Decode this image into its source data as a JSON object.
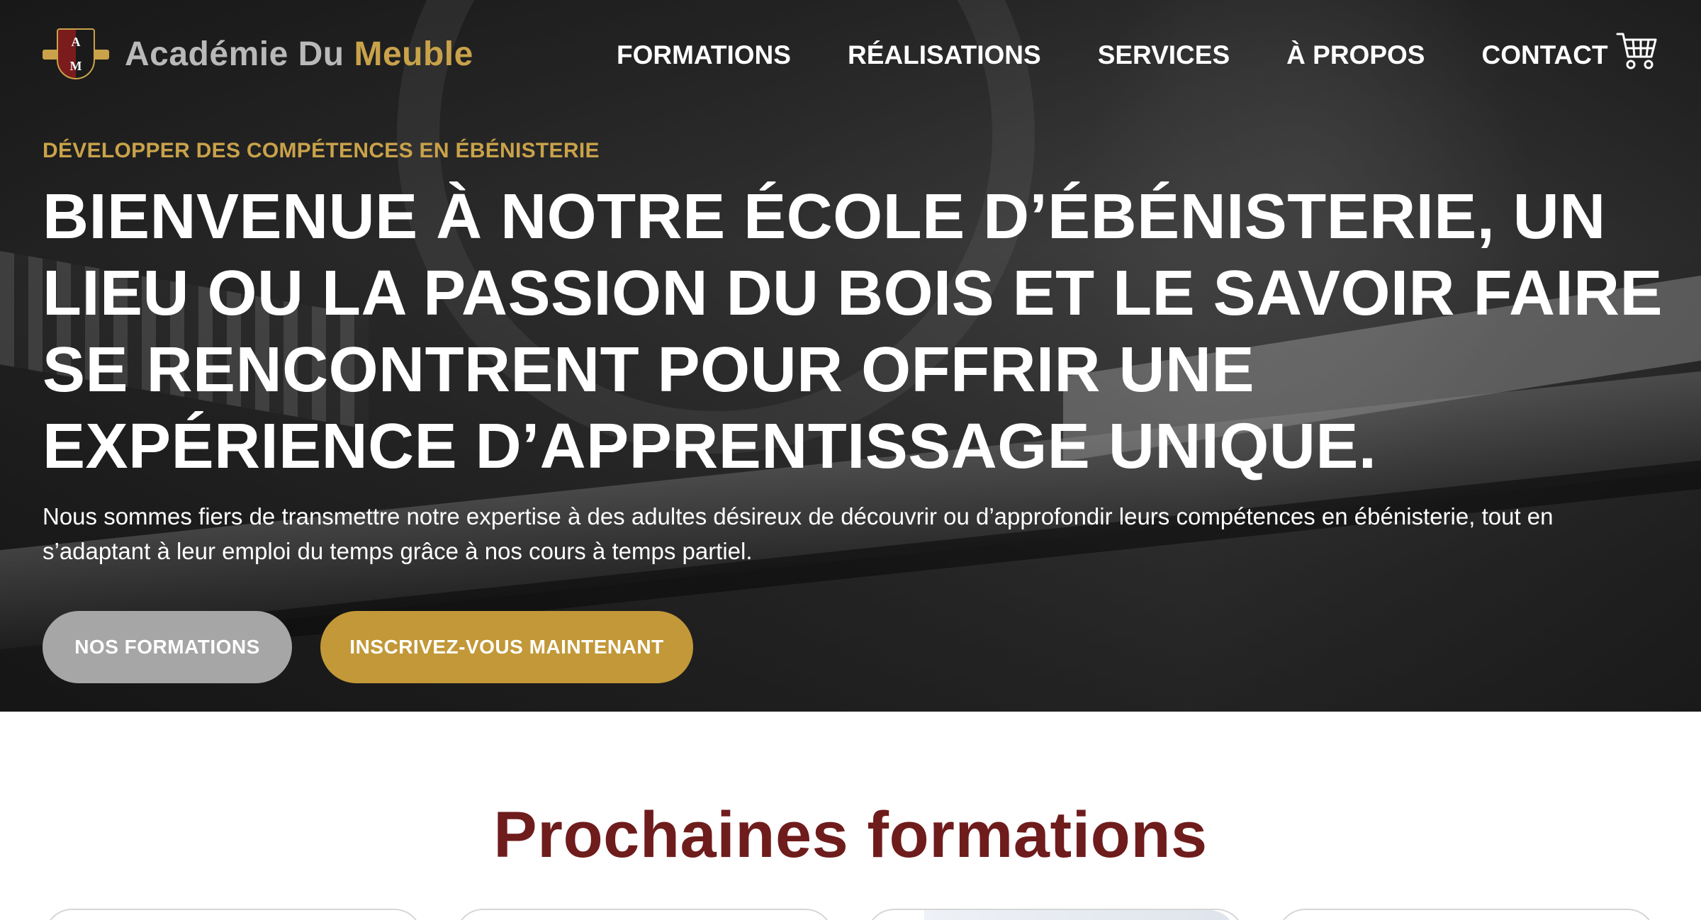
{
  "brand": {
    "name_part1": "Académie Du",
    "name_part2": "Meuble",
    "colors": {
      "gold": "#c9a24a",
      "grey": "#a6a6a6",
      "burgundy": "#6f1c1c"
    }
  },
  "nav": {
    "items": [
      {
        "label": "FORMATIONS"
      },
      {
        "label": "RÉALISATIONS"
      },
      {
        "label": "SERVICES"
      },
      {
        "label": "À PROPOS"
      },
      {
        "label": "CONTACT"
      }
    ],
    "cart_icon": "shopping-cart-icon"
  },
  "hero": {
    "kicker": "DÉVELOPPER DES COMPÉTENCES EN ÉBÉNISTERIE",
    "headline": "BIENVENUE À NOTRE ÉCOLE D’ÉBÉNISTERIE, UN LIEU OU LA PASSION DU BOIS ET LE SAVOIR FAIRE SE RENCONTRENT POUR OFFRIR UNE EXPÉRIENCE D’APPRENTISSAGE UNIQUE.",
    "lead": "Nous sommes fiers de transmettre notre expertise à des adultes désireux de découvrir ou d’approfondir leurs compétences en ébénisterie, tout en s’adaptant à leur emploi du temps grâce à nos cours à temps partiel.",
    "buttons": {
      "primary": "NOS FORMATIONS",
      "secondary": "INSCRIVEZ-VOUS MAINTENANT"
    }
  },
  "upcoming": {
    "title": "Prochaines formations"
  }
}
